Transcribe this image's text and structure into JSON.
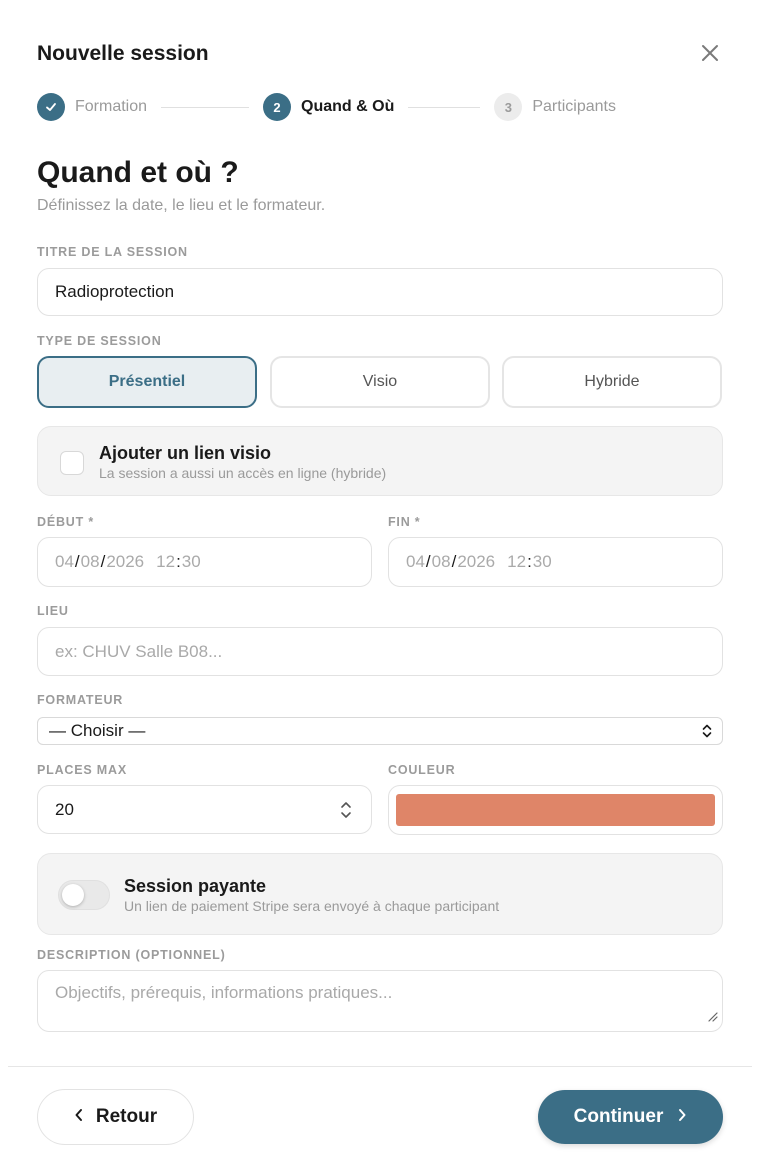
{
  "header": {
    "title": "Nouvelle session",
    "close_icon": "close-icon"
  },
  "stepper": {
    "steps": [
      {
        "number": "",
        "label": "Formation",
        "state": "done",
        "icon": "check-icon"
      },
      {
        "number": "2",
        "label": "Quand & Où",
        "state": "active"
      },
      {
        "number": "3",
        "label": "Participants",
        "state": "pending"
      }
    ]
  },
  "page": {
    "title": "Quand et où ?",
    "subtitle": "Définissez la date, le lieu et le formateur."
  },
  "form": {
    "session_title": {
      "label": "TITRE DE LA SESSION",
      "value": "Radioprotection"
    },
    "session_type": {
      "label": "TYPE DE SESSION",
      "options": [
        "Présentiel",
        "Visio",
        "Hybride"
      ],
      "selected": "Présentiel"
    },
    "visio_link": {
      "title": "Ajouter un lien visio",
      "description": "La session a aussi un accès en ligne (hybride)",
      "checked": false
    },
    "start": {
      "label": "DÉBUT *",
      "day": "04",
      "month": "08",
      "year": "2026",
      "hour": "12",
      "minute": "30"
    },
    "end": {
      "label": "FIN *",
      "day": "04",
      "month": "08",
      "year": "2026",
      "hour": "12",
      "minute": "30"
    },
    "location": {
      "label": "LIEU",
      "value": "",
      "placeholder": "ex: CHUV Salle B08..."
    },
    "trainer": {
      "label": "FORMATEUR",
      "value": "— Choisir —"
    },
    "max_places": {
      "label": "PLACES MAX",
      "value": "20"
    },
    "color": {
      "label": "COULEUR",
      "value": "#df8568"
    },
    "paid_session": {
      "title": "Session payante",
      "description": "Un lien de paiement Stripe sera envoyé à chaque participant",
      "enabled": false
    },
    "description": {
      "label": "DESCRIPTION (OPTIONNEL)",
      "value": "",
      "placeholder": "Objectifs, prérequis, informations pratiques..."
    }
  },
  "footer": {
    "back_label": "Retour",
    "continue_label": "Continuer"
  },
  "colors": {
    "accent": "#3b6e86",
    "accent_light": "#e8eef1"
  }
}
